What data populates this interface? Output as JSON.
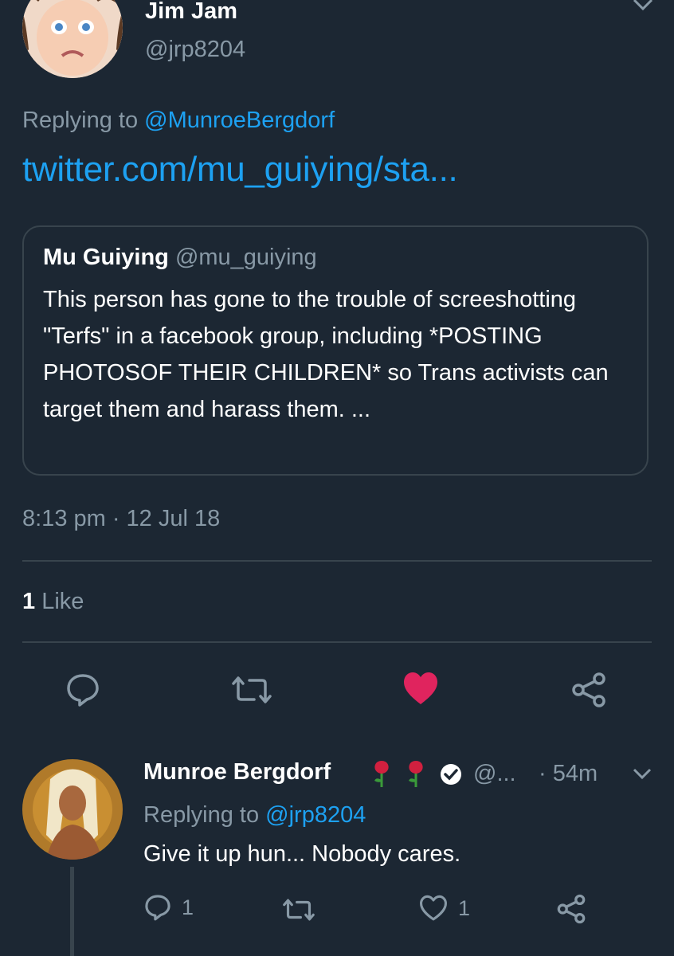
{
  "tweet": {
    "author_name": "Jim Jam",
    "author_handle": "@jrp8204",
    "replying_prefix": "Replying to",
    "replying_to": "@MunroeBergdorf",
    "link_text": "twitter.com/mu_guiying/sta...",
    "quoted": {
      "name": "Mu Guiying",
      "handle": "@mu_guiying",
      "text": "This person has gone to the trouble of screeshotting \"Terfs\" in a facebook group, including *POSTING PHOTOSOF THEIR CHILDREN* so Trans activists can target them and harass them. ..."
    },
    "timestamp": "8:13 pm · 12 Jul 18",
    "likes_count": "1",
    "likes_label": "Like"
  },
  "reply": {
    "author_name": "Munroe Bergdorf",
    "author_handle": "@...",
    "time": "· 54m",
    "replying_prefix": "Replying to",
    "replying_to": "@jrp8204",
    "text": "Give it up hun... Nobody cares.",
    "reply_count": "1",
    "like_count": "1"
  },
  "icons": {
    "reply": "comment-icon",
    "retweet": "retweet-icon",
    "like": "heart-icon",
    "share": "share-icon",
    "verified": "verified-badge-icon",
    "rose": "rose-emoji-icon",
    "chevron": "chevron-down-icon"
  },
  "colors": {
    "background": "#1c2733",
    "link": "#1da1f2",
    "muted": "#8899a6",
    "like_active": "#e0245e",
    "divider": "#38444d"
  }
}
